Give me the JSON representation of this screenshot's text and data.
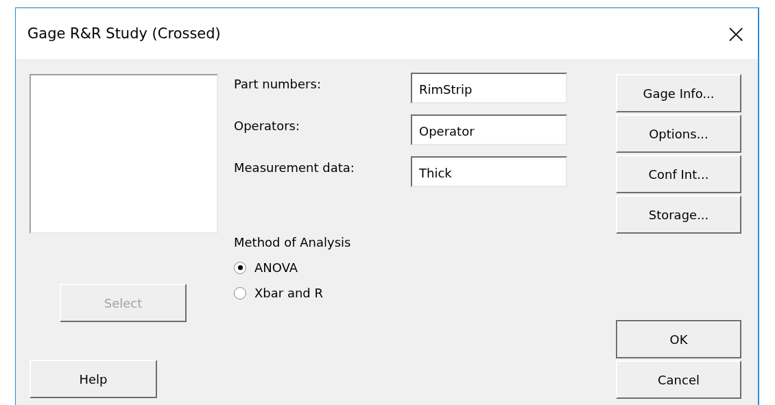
{
  "window": {
    "title": "Gage R&R Study (Crossed)",
    "close": "×"
  },
  "select_button": {
    "label": "Select",
    "disabled": true
  },
  "help_button": {
    "label": "Help"
  },
  "fields": [
    {
      "label": "Part numbers:",
      "value": "RimStrip"
    },
    {
      "label": "Operators:",
      "value": "Operator"
    },
    {
      "label": "Measurement data:",
      "value": "Thick"
    }
  ],
  "method": {
    "label": "Method of Analysis",
    "options": [
      {
        "label": "ANOVA",
        "selected": true
      },
      {
        "label": "Xbar and R",
        "selected": false
      }
    ]
  },
  "side_buttons": [
    {
      "label": "Gage Info..."
    },
    {
      "label": "Options..."
    },
    {
      "label": "Conf Int..."
    },
    {
      "label": "Storage..."
    }
  ],
  "ok_button": {
    "label": "OK",
    "default": true
  },
  "cancel_button": {
    "label": "Cancel"
  }
}
